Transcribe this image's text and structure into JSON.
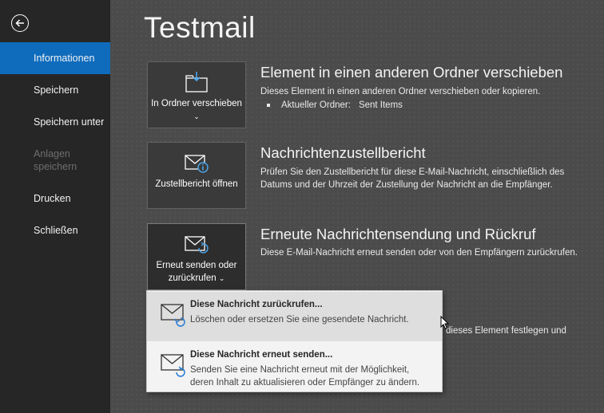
{
  "sidebar": {
    "back_icon": "arrow-left-circle-icon",
    "items": [
      {
        "label": "Informationen",
        "active": true
      },
      {
        "label": "Speichern"
      },
      {
        "label": "Speichern unter"
      },
      {
        "label": "Anlagen speichern",
        "disabled": true
      },
      {
        "label": "Drucken"
      },
      {
        "label": "Schließen"
      }
    ]
  },
  "main": {
    "title": "Testmail",
    "sections": {
      "move": {
        "button_label": "In Ordner verschieben",
        "title": "Element in einen anderen Ordner verschieben",
        "desc": "Dieses Element in einen anderen Ordner verschieben oder kopieren.",
        "folder_label": "Aktueller Ordner:",
        "folder_value": "Sent Items"
      },
      "delivery": {
        "button_label": "Zustellbericht öffnen",
        "title": "Nachrichtenzustellbericht",
        "desc": "Prüfen Sie den Zustellbericht für diese E-Mail-Nachricht, einschließlich des Datums und der Uhrzeit der Zustellung der Nachricht an die Empfänger."
      },
      "resend": {
        "button_label": "Erneut senden oder zurückrufen",
        "title": "Erneute Nachrichtensendung und Rückruf",
        "desc": "Diese E-Mail-Nachricht erneut senden oder von den Empfängern zurückrufen."
      },
      "partially_hidden_desc": "dieses Element festlegen und"
    }
  },
  "dropdown": {
    "items": [
      {
        "title": "Diese Nachricht zurückrufen...",
        "desc": "Löschen oder ersetzen Sie eine gesendete Nachricht."
      },
      {
        "title": "Diese Nachricht erneut senden...",
        "desc": "Senden Sie eine Nachricht erneut mit der Möglichkeit, deren Inhalt zu aktualisieren oder Empfänger zu ändern."
      }
    ]
  },
  "colors": {
    "sidebar_bg": "#262626",
    "active_item": "#0f6cbd",
    "main_bg": "#4b4b4b",
    "accent_icon": "#4aa3e8"
  }
}
